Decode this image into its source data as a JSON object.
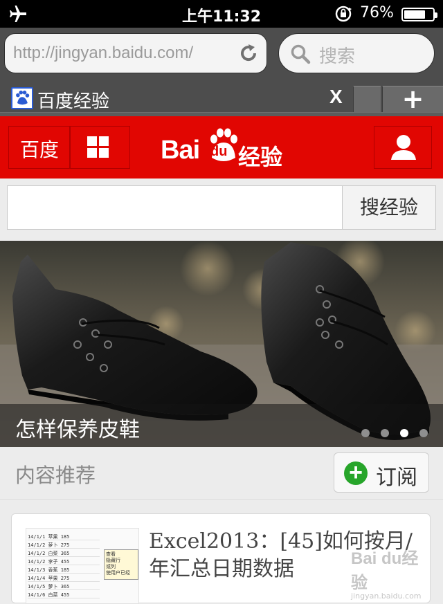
{
  "status_bar": {
    "time": "上午11:32",
    "battery_text": "76%",
    "battery_level": 0.76,
    "icons": [
      "airplane-icon",
      "rotation-lock-icon",
      "battery-icon"
    ]
  },
  "browser": {
    "url": "http://jingyan.baidu.com/",
    "search_placeholder": "搜索",
    "tab_title": "百度经验",
    "tab_close": "X",
    "new_tab": "+"
  },
  "header": {
    "baidu_link": "百度",
    "logo_bai": "Bai",
    "logo_du": "du",
    "logo_jingyan": "经验",
    "brand_color": "#e10602"
  },
  "search": {
    "value": "",
    "button": "搜经验"
  },
  "banner": {
    "caption": "怎样保养皮鞋",
    "slide_count": 4,
    "active_slide": 3
  },
  "section": {
    "title": "内容推荐",
    "subscribe": "订阅",
    "subscribe_color": "#27a52a"
  },
  "articles": [
    {
      "title": "Excel2013：[45]如何按月/年汇总日期数据",
      "watermark_logo": "Bai du经验",
      "watermark_url": "jingyan.baidu.com",
      "thumb_rows": [
        "14/1/1 苹果 185",
        "14/1/2 萝卜 275",
        "14/1/2 白菜 365",
        "14/1/2 李子 455",
        "14/1/3 香蕉 185",
        "14/1/4 苹果 275",
        "14/1/5 萝卜 365",
        "14/1/6 白菜 455"
      ],
      "thumb_popup": [
        "查看",
        "隐藏行",
        "或列",
        "使用户已经"
      ]
    }
  ]
}
